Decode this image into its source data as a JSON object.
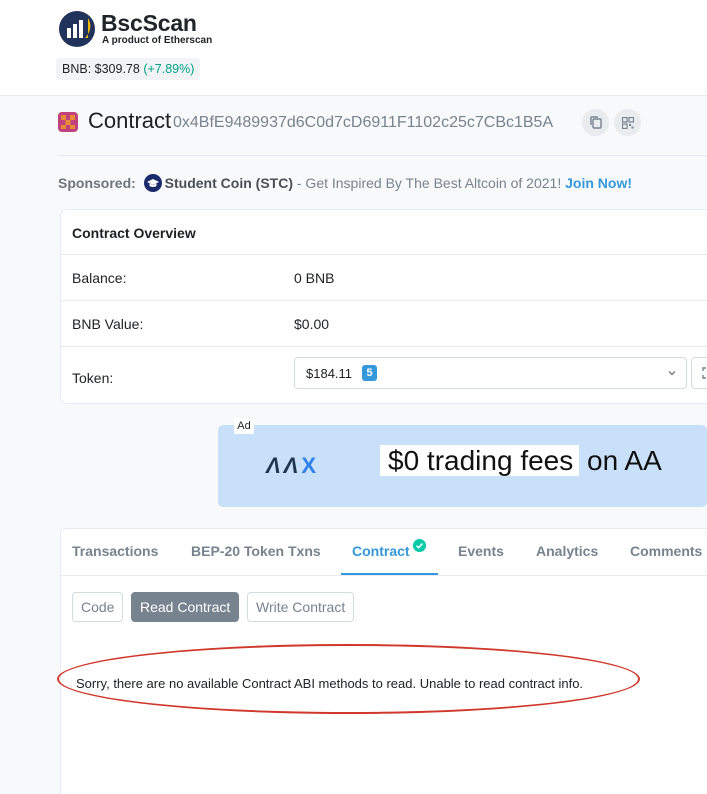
{
  "brand": {
    "name": "BscScan",
    "tagline": "A product of Etherscan"
  },
  "price": {
    "label": "BNB: $309.78",
    "change": "(+7.89%)"
  },
  "contract": {
    "title": "Contract",
    "address": "0x4BfE9489937d6C0d7cD6911F1102c25c7CBc1B5A"
  },
  "sponsored": {
    "label": "Sponsored:",
    "coin": "Student Coin (STC)",
    "text": " - Get Inspired By The Best Altcoin of 2021! ",
    "cta": "Join Now!"
  },
  "overview": {
    "title": "Contract Overview",
    "balance_label": "Balance:",
    "balance_value": "0 BNB",
    "value_label": "BNB Value:",
    "value_value": "$0.00",
    "token_label": "Token:",
    "token_value": "$184.11",
    "token_count": "5"
  },
  "ad": {
    "label": "Ad",
    "brand_a": "ΛΛ",
    "brand_x": "X",
    "highlight": "$0 trading fees",
    "rest": " on AA"
  },
  "tabs": [
    {
      "label": "Transactions"
    },
    {
      "label": "BEP-20 Token Txns"
    },
    {
      "label": "Contract"
    },
    {
      "label": "Events"
    },
    {
      "label": "Analytics"
    },
    {
      "label": "Comments"
    }
  ],
  "subtabs": [
    {
      "label": "Code"
    },
    {
      "label": "Read Contract"
    },
    {
      "label": "Write Contract"
    }
  ],
  "message": "Sorry, there are no available Contract ABI methods to read. Unable to read contract info.",
  "colors": {
    "accent": "#3498db",
    "positive": "#00a186",
    "highlight_ring": "#d0382b"
  }
}
